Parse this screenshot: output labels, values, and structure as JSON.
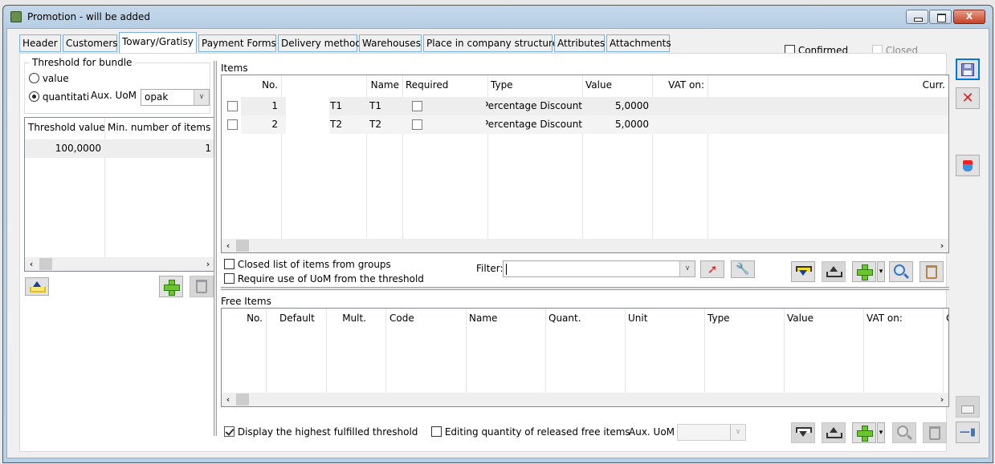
{
  "window": {
    "title": "Promotion - will be added",
    "controls": {
      "minimize": "minimize",
      "maximize": "maximize",
      "close": "X"
    }
  },
  "tabs": [
    {
      "label": "Header",
      "active": false
    },
    {
      "label": "Customers",
      "active": false
    },
    {
      "label": "Towary/Gratisy",
      "active": true
    },
    {
      "label": "Payment Forms",
      "active": false
    },
    {
      "label": "Delivery method",
      "active": false
    },
    {
      "label": "Warehouses",
      "active": false
    },
    {
      "label": "Place in company structure",
      "active": false
    },
    {
      "label": "Attributes",
      "active": false
    },
    {
      "label": "Attachments",
      "active": false
    }
  ],
  "header_flags": {
    "confirmed": {
      "label": "Confirmed",
      "checked": false
    },
    "closed": {
      "label": "Closed",
      "checked": false,
      "disabled": true
    }
  },
  "threshold": {
    "group_label": "Threshold for bundle",
    "options": [
      {
        "label": "value",
        "selected": false
      },
      {
        "label": "quantitativ",
        "selected": true
      }
    ],
    "aux_uom_label": "Aux. UoM",
    "aux_uom_value": "opak",
    "grid": {
      "columns": [
        "Threshold value",
        "Min. number of items"
      ],
      "rows": [
        [
          "100,0000",
          "1"
        ]
      ]
    }
  },
  "items": {
    "section_label": "Items",
    "columns": [
      "No.",
      "",
      "Name",
      "Required",
      "Type",
      "Value",
      "VAT on:",
      "Curr."
    ],
    "rows": [
      {
        "selected": false,
        "no": "1",
        "code": "T1",
        "name": "T1",
        "required": false,
        "type": "Percentage Discount",
        "value": "5,0000",
        "vat": "",
        "curr": ""
      },
      {
        "selected": false,
        "no": "2",
        "code": "T2",
        "name": "T2",
        "required": false,
        "type": "Percentage Discount",
        "value": "5,0000",
        "vat": "",
        "curr": ""
      }
    ],
    "closed_list_label": "Closed list of items from groups",
    "require_uom_label": "Require use of UoM from the threshold",
    "filter_label": "Filter:",
    "filter_value": ""
  },
  "free_items": {
    "section_label": "Free Items",
    "columns": [
      "No.",
      "Default",
      "Mult.",
      "Code",
      "Name",
      "Quant.",
      "Unit",
      "Type",
      "Value",
      "VAT on:",
      "C"
    ],
    "rows": [],
    "display_highest_label": "Display the highest fulfilled threshold",
    "display_highest_checked": true,
    "editing_quantity_label": "Editing quantity of released free items",
    "editing_quantity_checked": false,
    "aux_uom_label": "Aux. UoM",
    "aux_uom_value": ""
  },
  "icons": {
    "save": "save-icon",
    "cancel": "close-icon",
    "export": "database-export-icon",
    "lock": "lock-icon",
    "pin": "pin-icon"
  }
}
